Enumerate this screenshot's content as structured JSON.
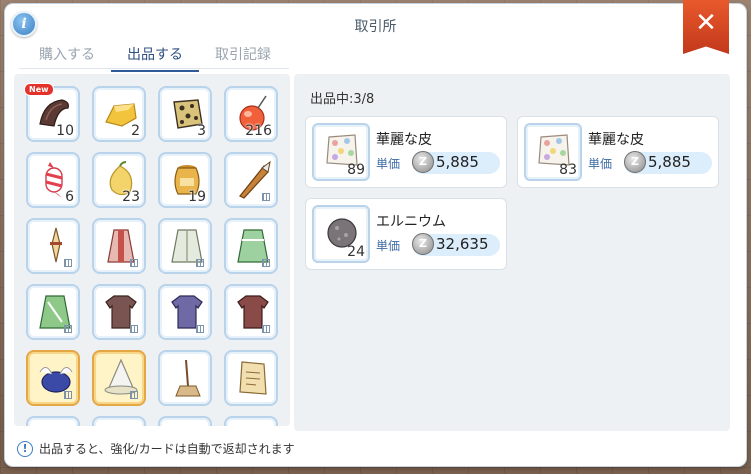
{
  "window": {
    "title": "取引所"
  },
  "tabs": [
    {
      "label": "購入する",
      "active": false
    },
    {
      "label": "出品する",
      "active": true
    },
    {
      "label": "取引記録",
      "active": false
    }
  ],
  "inventory": [
    {
      "name": "item-1",
      "qty": "10",
      "new": true,
      "badge": "New"
    },
    {
      "name": "item-2",
      "qty": "2"
    },
    {
      "name": "item-3",
      "qty": "3"
    },
    {
      "name": "item-4",
      "qty": "216"
    },
    {
      "name": "item-5",
      "qty": "6"
    },
    {
      "name": "item-6",
      "qty": "23"
    },
    {
      "name": "item-7",
      "qty": "19"
    },
    {
      "name": "item-8",
      "qty": ""
    },
    {
      "name": "item-9",
      "qty": ""
    },
    {
      "name": "item-10",
      "qty": ""
    },
    {
      "name": "item-11",
      "qty": ""
    },
    {
      "name": "item-12",
      "qty": ""
    },
    {
      "name": "item-13",
      "qty": ""
    },
    {
      "name": "item-14",
      "qty": ""
    },
    {
      "name": "item-15",
      "qty": ""
    },
    {
      "name": "item-16",
      "qty": ""
    },
    {
      "name": "item-17",
      "qty": ""
    },
    {
      "name": "item-18",
      "qty": ""
    },
    {
      "name": "item-19",
      "qty": ""
    },
    {
      "name": "item-20",
      "qty": ""
    }
  ],
  "listings": {
    "count_label": "出品中:3/8",
    "items": [
      {
        "name": "華麗な皮",
        "qty": "89",
        "unit_label": "単価",
        "price": "5,885"
      },
      {
        "name": "華麗な皮",
        "qty": "83",
        "unit_label": "単価",
        "price": "5,885"
      },
      {
        "name": "エルニウム",
        "qty": "24",
        "unit_label": "単価",
        "price": "32,635"
      }
    ]
  },
  "footer": {
    "note": "出品すると、強化/カードは自動で返却されます"
  },
  "icons": {
    "info": "info-icon",
    "close": "close-icon",
    "zeny": "zeny-coin-icon",
    "notice": "notice-icon"
  },
  "colors": {
    "accent": "#2f5a9a",
    "close": "#d9482a",
    "slot_border": "#b9d3ea",
    "gold_slot": "#e5a646"
  }
}
